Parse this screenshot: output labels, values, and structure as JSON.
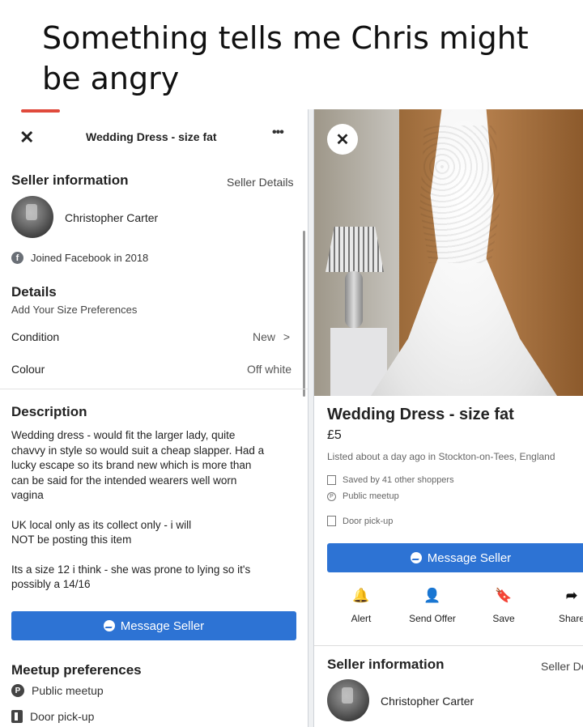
{
  "caption": {
    "line1": "Something tells me Chris might",
    "line2": "be angry"
  },
  "left": {
    "header": {
      "close_icon": "✕",
      "title": "Wedding Dress - size fat",
      "more_icon": "•••"
    },
    "seller": {
      "section_title": "Seller information",
      "details_link": "Seller Details",
      "name": "Christopher Carter",
      "joined": "Joined Facebook in 2018",
      "joined_icon": "f"
    },
    "details": {
      "section_title": "Details",
      "size_link": "Add Your Size Preferences",
      "condition_label": "Condition",
      "condition_value": "New",
      "condition_chevron": ">",
      "colour_label": "Colour",
      "colour_value": "Off white"
    },
    "description": {
      "section_title": "Description",
      "p1_l1": "Wedding dress - would fit the larger lady, quite",
      "p1_l2": "chavvy in style so would suit a cheap slapper. Had a",
      "p1_l3": "lucky escape so its brand new which is more than",
      "p1_l4": "can be said for the intended wearers well worn",
      "p1_l5": "vagina",
      "p2_l1": "UK local only as its collect only - i will",
      "p2_l2": "NOT be posting this item",
      "p3_l1": "Its a size 12 i think - she was prone to lying so it's",
      "p3_l2": "possibly a 14/16"
    },
    "message_button": "Message Seller",
    "meetup": {
      "section_title": "Meetup preferences",
      "public": "Public meetup",
      "public_icon": "P",
      "door": "Door pick-up"
    }
  },
  "right": {
    "close_icon": "✕",
    "photo_dots": "• •",
    "title": "Wedding Dress - size fat",
    "price": "£5",
    "listed": "Listed about a day ago in Stockton-on-Tees, England",
    "saved": "Saved by 41 other shoppers",
    "public": "Public meetup",
    "public_icon": "P",
    "door": "Door pick-up",
    "message_button": "Message Seller",
    "actions": [
      {
        "icon": "🔔",
        "label": "Alert"
      },
      {
        "icon": "👤",
        "label": "Send Offer"
      },
      {
        "icon": "🔖",
        "label": "Save"
      },
      {
        "icon": "➦",
        "label": "Share"
      }
    ],
    "seller_title": "Seller information",
    "seller_details": "Seller Details",
    "seller_name": "Christopher Carter"
  }
}
